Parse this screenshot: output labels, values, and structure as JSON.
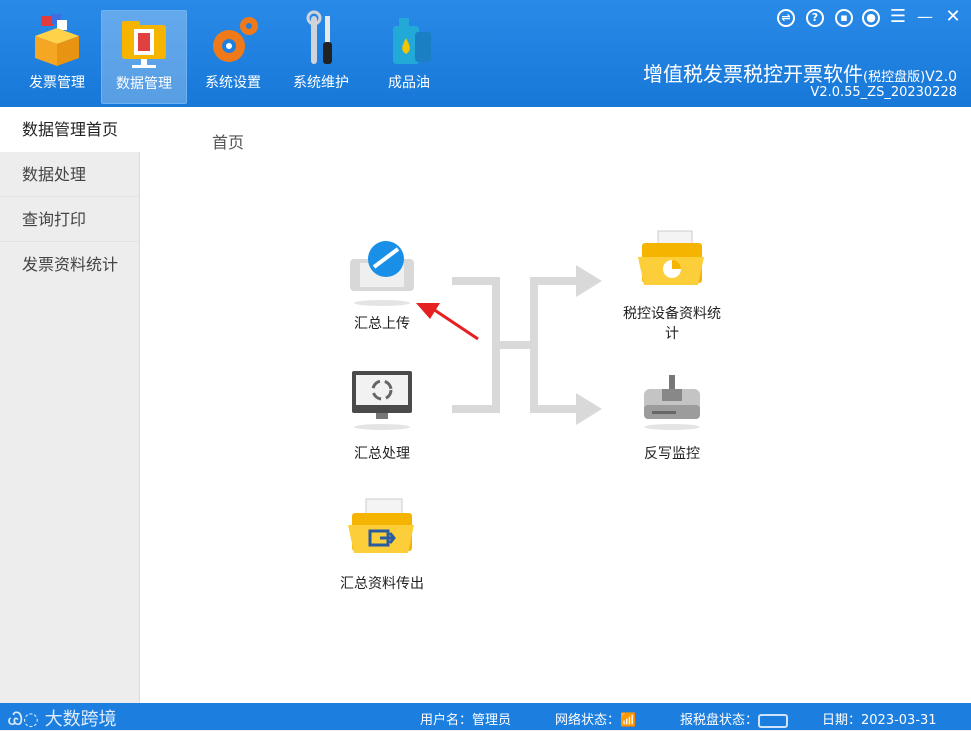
{
  "header": {
    "nav": [
      {
        "label": "发票管理",
        "icon": "invoice-box-icon"
      },
      {
        "label": "数据管理",
        "icon": "data-folder-icon",
        "active": true
      },
      {
        "label": "系统设置",
        "icon": "gears-icon"
      },
      {
        "label": "系统维护",
        "icon": "tools-icon"
      },
      {
        "label": "成品油",
        "icon": "oil-can-icon"
      }
    ],
    "title_main": "增值税发票税控开票软件",
    "title_sub": "(税控盘版)",
    "title_ver": "V2.0",
    "build": "V2.0.55_ZS_20230228",
    "colors": {
      "header": "#1c7fe0",
      "accent": "#f5b400"
    }
  },
  "sidebar": {
    "items": [
      "数据管理首页",
      "数据处理",
      "查询打印",
      "发票资料统计"
    ]
  },
  "main": {
    "breadcrumb": "首页",
    "tiles": {
      "upload": "汇总上传",
      "process": "汇总处理",
      "export": "汇总资料传出",
      "stats": "税控设备资料统",
      "stats2": "计",
      "monitor": "反写监控"
    }
  },
  "statusbar": {
    "watermark": "大数跨境",
    "user_label": "用户名：",
    "user_value": "管理员",
    "network_label": "网络状态：",
    "disk_label": "报税盘状态：",
    "date_label": "日期：",
    "date_value": "2023-03-31"
  }
}
